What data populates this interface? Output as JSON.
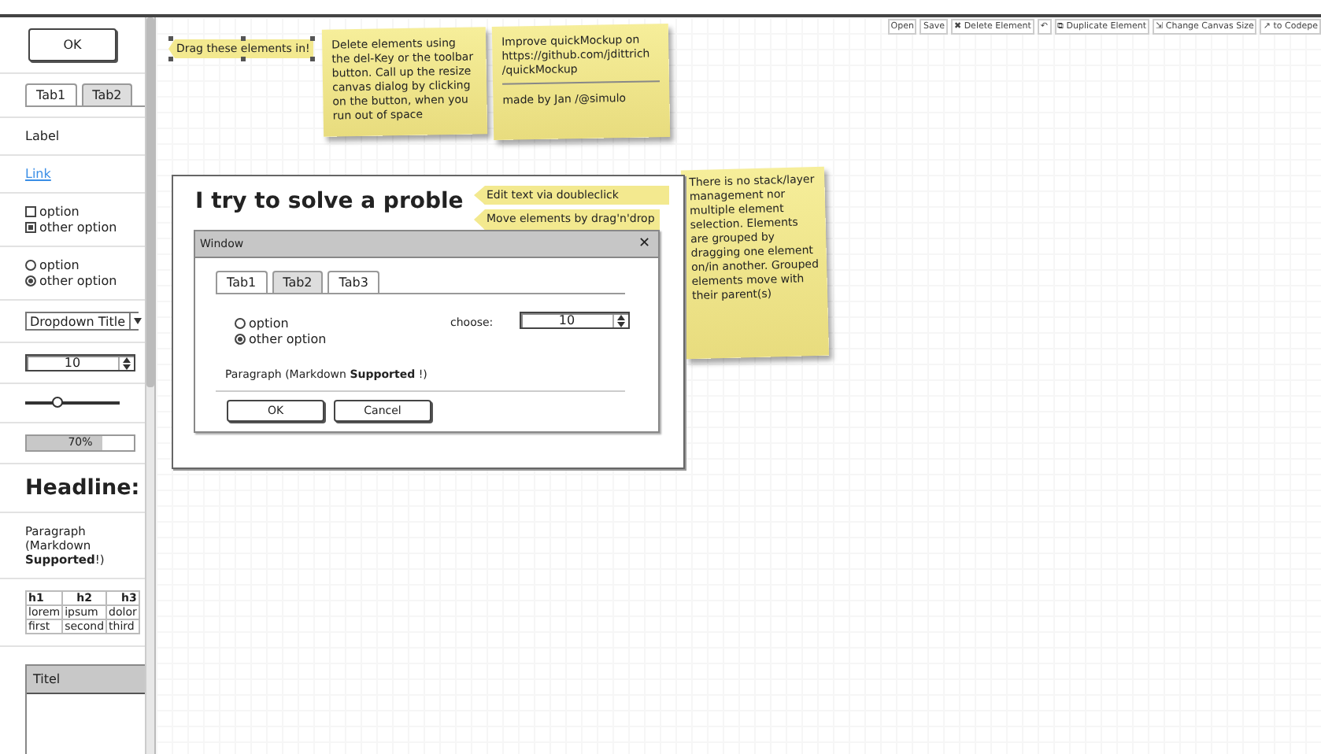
{
  "toolbar": {
    "buttons": [
      {
        "label": "Open"
      },
      {
        "label": "Save"
      },
      {
        "label": "✖ Delete Element"
      },
      {
        "label": "↶"
      },
      {
        "label": "⧉ Duplicate Element"
      },
      {
        "label": "⇲ Change Canvas Size"
      },
      {
        "label": "↗ to Codepe"
      }
    ]
  },
  "palette": {
    "button": "OK",
    "tabs": [
      {
        "label": "Tab1",
        "selected": true
      },
      {
        "label": "Tab2",
        "selected": false
      }
    ],
    "label": "Label",
    "link": "Link",
    "checkboxes": [
      {
        "label": "option",
        "checked": false
      },
      {
        "label": "other option",
        "checked": true
      }
    ],
    "radios": [
      {
        "label": "option",
        "selected": false
      },
      {
        "label": "other option",
        "selected": true
      }
    ],
    "dropdown": "Dropdown Title",
    "spinner": "10",
    "slider": {
      "level": 0.35
    },
    "progress": {
      "level": 0.7,
      "text": "70%"
    },
    "headline": "Headline:",
    "paragraph": "Paragraph (Markdown **Supported**!)",
    "table": {
      "columns": [
        "h1",
        "h2",
        "h3"
      ],
      "rows": [
        [
          "lorem",
          "ipsum",
          "dolor"
        ],
        [
          "first",
          "second",
          "third"
        ]
      ]
    },
    "list": {
      "title": "Titel"
    }
  },
  "canvas": {
    "notes": [
      {
        "kind": "selected-label",
        "texts": [
          "Drag these elements in!"
        ]
      },
      {
        "kind": "sticky",
        "texts": [
          "Delete elements using the del-Key or the toolbar button. Call up the resize canvas dialog by clicking on the button, when you run out of space"
        ]
      },
      {
        "kind": "sticky",
        "texts": [
          "Improve quickMockup on https://github.com/jdittrich /quickMockup",
          "made by Jan /@simulo"
        ]
      },
      {
        "kind": "tip",
        "texts": [
          "Edit text via doubleclick"
        ]
      },
      {
        "kind": "tip",
        "texts": [
          "Move elements by drag'n'drop"
        ]
      },
      {
        "kind": "sticky",
        "texts": [
          "There is no stack/layer management nor multiple element selection. Elements are grouped by dragging one element on/in another. Grouped elements move with their parent(s)"
        ]
      }
    ],
    "frame": {
      "headline": "I try to solve a proble",
      "window": {
        "title": "Window",
        "close": "✕",
        "tabs": [
          {
            "label": "Tab1",
            "selected": true
          },
          {
            "label": "Tab2",
            "selected": false
          },
          {
            "label": "Tab3",
            "selected": true
          }
        ],
        "radios": [
          {
            "label": "option",
            "selected": false
          },
          {
            "label": "other option",
            "selected": true
          }
        ],
        "choose_label": "choose:",
        "spinner": "10",
        "paragraph": "Paragraph (Markdown **Supported** !)",
        "buttons": [
          "OK",
          "Cancel"
        ]
      }
    }
  }
}
